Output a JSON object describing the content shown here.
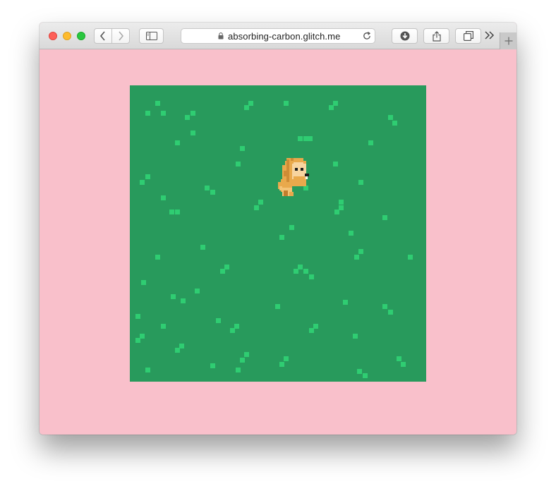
{
  "browser": {
    "address_url": "absorbing-carbon.glitch.me",
    "page_background": "#f9c0cb"
  },
  "icons": {
    "back": "chevron-left-icon",
    "forward": "chevron-right-icon",
    "sidebar": "sidebar-icon",
    "lock": "lock-icon",
    "reload": "reload-icon",
    "downloads": "download-icon",
    "share": "share-icon",
    "tabs": "tabs-overview-icon",
    "more": "double-chevron-icon",
    "new_tab": "plus-icon"
  },
  "game": {
    "grass_color": "#289a5c",
    "tuft_color": "#2fcd72",
    "player": "lion"
  }
}
